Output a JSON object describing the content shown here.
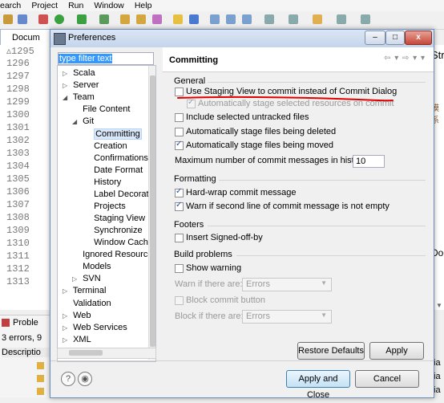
{
  "menubar": [
    "earch",
    "Project",
    "Run",
    "Window",
    "Help"
  ],
  "editor": {
    "tab_label": "Docum",
    "line_numbers": [
      "▵1295",
      "1296",
      "1297",
      "1298",
      "1299",
      "1300",
      "1301",
      "1302",
      "1303",
      "1304",
      "1305",
      "1306",
      "1307",
      "1308",
      "1309",
      "1310",
      "1311",
      "1312",
      "1313"
    ],
    "right_text": [
      "Str",
      "模系",
      ";",
      "Docu",
      "▼"
    ]
  },
  "bottom_panel": {
    "tab_label": "Proble",
    "summary": "3 errors, 9",
    "column": "Descriptio",
    "right_rows": [
      "ia",
      "ia",
      "ia"
    ]
  },
  "dialog": {
    "title": "Preferences",
    "window_buttons": [
      "–",
      "□",
      "x"
    ],
    "filter_text": "type filter text",
    "tree": [
      {
        "label": "Scala",
        "twisty": "▷",
        "level": 0
      },
      {
        "label": "Server",
        "twisty": "▷",
        "level": 0
      },
      {
        "label": "Team",
        "twisty": "◢",
        "level": 0
      },
      {
        "label": "File Content",
        "twisty": "",
        "level": 1
      },
      {
        "label": "Git",
        "twisty": "◢",
        "level": 1
      },
      {
        "label": "Committing",
        "twisty": "",
        "level": 2,
        "selected": true
      },
      {
        "label": "Creation",
        "twisty": "",
        "level": 2
      },
      {
        "label": "Confirmations a",
        "twisty": "",
        "level": 2
      },
      {
        "label": "Date Format",
        "twisty": "",
        "level": 2
      },
      {
        "label": "History",
        "twisty": "",
        "level": 2
      },
      {
        "label": "Label Decoratic",
        "twisty": "",
        "level": 2
      },
      {
        "label": "Projects",
        "twisty": "",
        "level": 2
      },
      {
        "label": "Staging View",
        "twisty": "",
        "level": 2
      },
      {
        "label": "Synchronize",
        "twisty": "",
        "level": 2
      },
      {
        "label": "Window Cache",
        "twisty": "",
        "level": 2
      },
      {
        "label": "Ignored Resource",
        "twisty": "",
        "level": 1
      },
      {
        "label": "Models",
        "twisty": "",
        "level": 1
      },
      {
        "label": "SVN",
        "twisty": "▷",
        "level": 1
      },
      {
        "label": "Terminal",
        "twisty": "▷",
        "level": 0
      },
      {
        "label": "Validation",
        "twisty": "",
        "level": 0
      },
      {
        "label": "Web",
        "twisty": "▷",
        "level": 0
      },
      {
        "label": "Web Services",
        "twisty": "▷",
        "level": 0
      },
      {
        "label": "XML",
        "twisty": "▷",
        "level": 0
      }
    ],
    "page_title": "Committing",
    "nav_arrows": "⇦ ▾ ⇨ ▾ ▾",
    "general": {
      "heading": "General",
      "use_staging_view": {
        "label": "Use Staging View to commit instead of Commit Dialog",
        "checked": false
      },
      "auto_stage": {
        "label": "Automatically stage selected resources on commit",
        "checked": true,
        "disabled": true
      },
      "include_untracked": {
        "label": "Include selected untracked files",
        "checked": false
      },
      "stage_deleted": {
        "label": "Automatically stage files being deleted",
        "checked": false
      },
      "stage_moved": {
        "label": "Automatically stage files being moved",
        "checked": true
      },
      "max_label": "Maximum number of commit messages in history:",
      "max_value": "10"
    },
    "formatting": {
      "heading": "Formatting",
      "hard_wrap": {
        "label": "Hard-wrap commit message",
        "checked": true
      },
      "warn_second_line": {
        "label": "Warn if second line of commit message is not empty",
        "checked": true
      }
    },
    "footers": {
      "heading": "Footers",
      "signed_off": {
        "label": "Insert Signed-off-by",
        "checked": false
      }
    },
    "build_problems": {
      "heading": "Build problems",
      "show_warning": {
        "label": "Show warning",
        "checked": false
      },
      "warn_label": "Warn if there are:",
      "warn_value": "Errors",
      "block_commit": {
        "label": "Block commit button",
        "checked": false
      },
      "block_label": "Block if there are:",
      "block_value": "Errors"
    },
    "buttons": {
      "restore": "Restore Defaults",
      "apply": "Apply",
      "apply_close": "Apply and Close",
      "cancel": "Cancel",
      "help": "?",
      "prefs": "◉"
    },
    "annotation_color": "#e00000"
  }
}
